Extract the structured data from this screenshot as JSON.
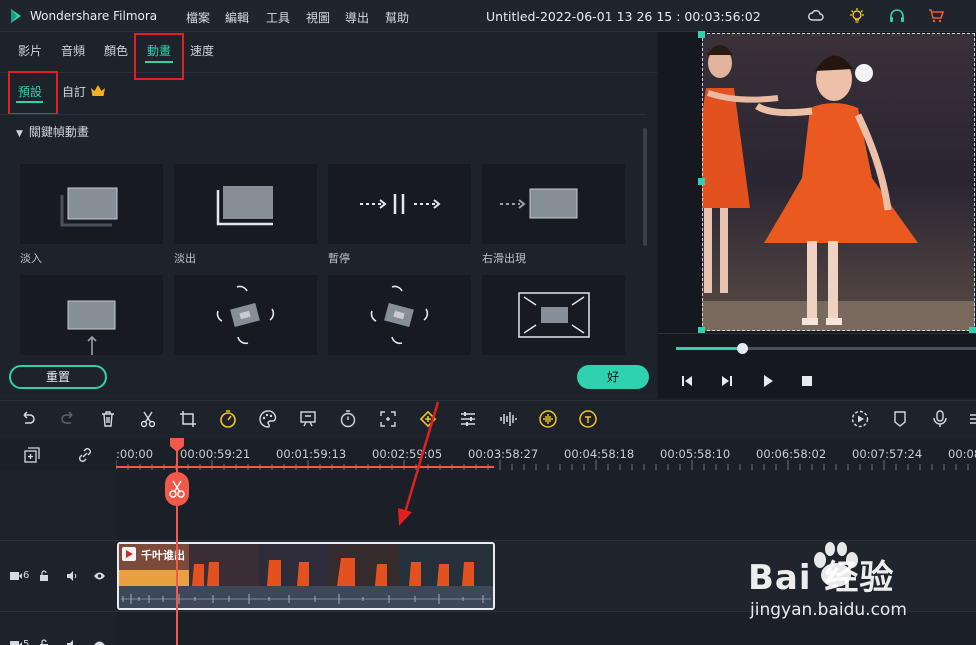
{
  "app": {
    "name": "Wondershare Filmora",
    "menus": [
      "檔案",
      "編輯",
      "工具",
      "視圖",
      "導出",
      "幫助"
    ],
    "window_title": "Untitled-2022-06-01 13 26 15 : 00:03:56:02"
  },
  "panel": {
    "tabs": [
      "影片",
      "音頻",
      "顏色",
      "動畫",
      "速度"
    ],
    "active_tab": "動畫",
    "subtabs": [
      "預設",
      "自訂"
    ],
    "active_subtab": "預設",
    "section_title": "關鍵幀動畫",
    "presets": [
      "淡入",
      "淡出",
      "暫停",
      "右滑出現",
      "",
      "",
      "",
      ""
    ],
    "reset_label": "重置",
    "ok_label": "好"
  },
  "player": {
    "progress": 0.22
  },
  "timeline": {
    "ruler_labels": [
      ":00:00",
      "00:00:59:21",
      "00:01:59:13",
      "00:02:59:05",
      "00:03:58:27",
      "00:04:58:18",
      "00:05:58:10",
      "00:06:58:02",
      "00:07:57:24",
      "00:08"
    ],
    "video_track_number": "6",
    "second_track_number": "5",
    "clip_title": "千叶谁出"
  },
  "watermark": {
    "brand": "Bai 经验",
    "url": "jingyan.baidu.com"
  },
  "colors": {
    "accent": "#2fd1ae",
    "highlight_box": "#e02121",
    "playhead": "#f2594b",
    "annotation_arrow": "#e02121"
  }
}
